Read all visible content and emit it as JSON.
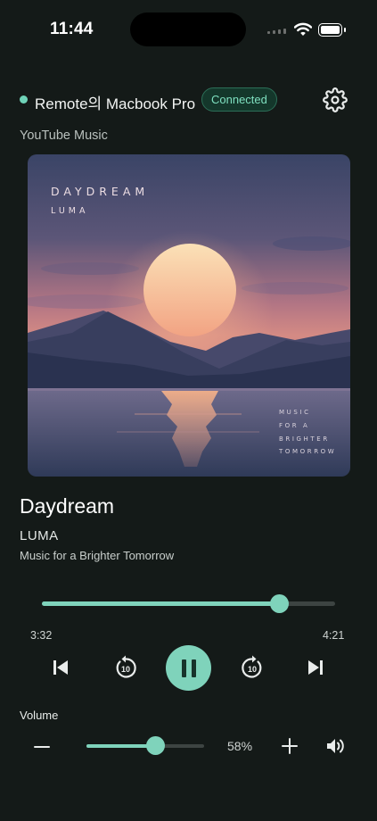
{
  "status_bar": {
    "time": "11:44",
    "battery_icon": "battery-full-icon",
    "wifi_icon": "wifi-icon"
  },
  "header": {
    "device_name": "Remote의 Macbook Pro",
    "connection_status": "Connected",
    "status_color": "#6fd3b8",
    "settings_icon": "gear-icon"
  },
  "source": {
    "label": "YouTube Music"
  },
  "album_art": {
    "title_text": "DAYDREAM",
    "artist_text": "LUMA",
    "tagline_lines": [
      "MUSIC",
      "FOR A",
      "BRIGHTER",
      "TOMORROW"
    ]
  },
  "track": {
    "title": "Daydream",
    "artist": "LUMA",
    "album": "Music for a Brighter Tomorrow"
  },
  "progress": {
    "elapsed": "3:32",
    "total": "4:21",
    "fraction": 0.81
  },
  "controls": {
    "previous_icon": "skip-previous-icon",
    "rewind_icon": "replay-10-icon",
    "rewind_seconds": "10",
    "play_pause_icon": "pause-icon",
    "forward_icon": "forward-10-icon",
    "forward_seconds": "10",
    "next_icon": "skip-next-icon"
  },
  "volume": {
    "label": "Volume",
    "percent_text": "58%",
    "level": 0.58,
    "decrease_icon": "minus-icon",
    "increase_icon": "plus-icon",
    "speaker_icon": "speaker-icon"
  },
  "colors": {
    "accent": "#7fd3bb",
    "background": "#141a18",
    "badge_bg": "#14372b"
  }
}
